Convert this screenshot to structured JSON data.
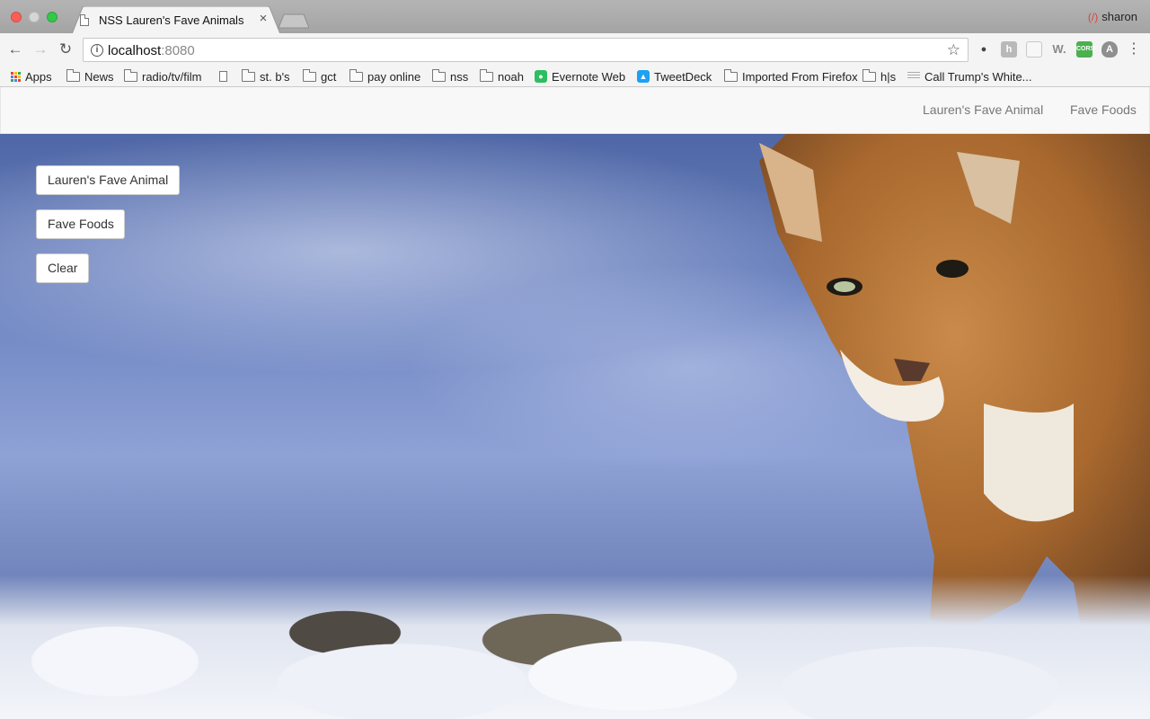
{
  "browser": {
    "tab_title": "NSS Lauren's Fave Animals",
    "profile_name": "sharon",
    "url_host": "localhost",
    "url_port": ":8080"
  },
  "bookmarks": [
    {
      "label": "Apps",
      "icon": "apps-grid-icon"
    },
    {
      "label": "News",
      "icon": "folder-icon"
    },
    {
      "label": "radio/tv/film",
      "icon": "folder-icon"
    },
    {
      "label": "",
      "icon": "page-icon"
    },
    {
      "label": "st. b's",
      "icon": "folder-icon"
    },
    {
      "label": "gct",
      "icon": "folder-icon"
    },
    {
      "label": "pay online",
      "icon": "folder-icon"
    },
    {
      "label": "nss",
      "icon": "folder-icon"
    },
    {
      "label": "noah",
      "icon": "folder-icon"
    },
    {
      "label": "Evernote Web",
      "icon": "evernote-icon"
    },
    {
      "label": "TweetDeck",
      "icon": "tweetdeck-icon"
    },
    {
      "label": "Imported From Firefox",
      "icon": "folder-icon"
    },
    {
      "label": "h|s",
      "icon": "folder-icon"
    },
    {
      "label": "Call Trump's White...",
      "icon": "whitehouse-icon"
    }
  ],
  "page": {
    "nav": {
      "link_1": "Lauren's Fave Animal",
      "link_2": "Fave Foods"
    },
    "buttons": {
      "animal": "Lauren's Fave Animal",
      "foods": "Fave Foods",
      "clear": "Clear"
    }
  },
  "colors": {
    "sky_blue": "#6f86c2",
    "navbar_bg": "#f8f8f8",
    "nav_link": "#777777"
  }
}
